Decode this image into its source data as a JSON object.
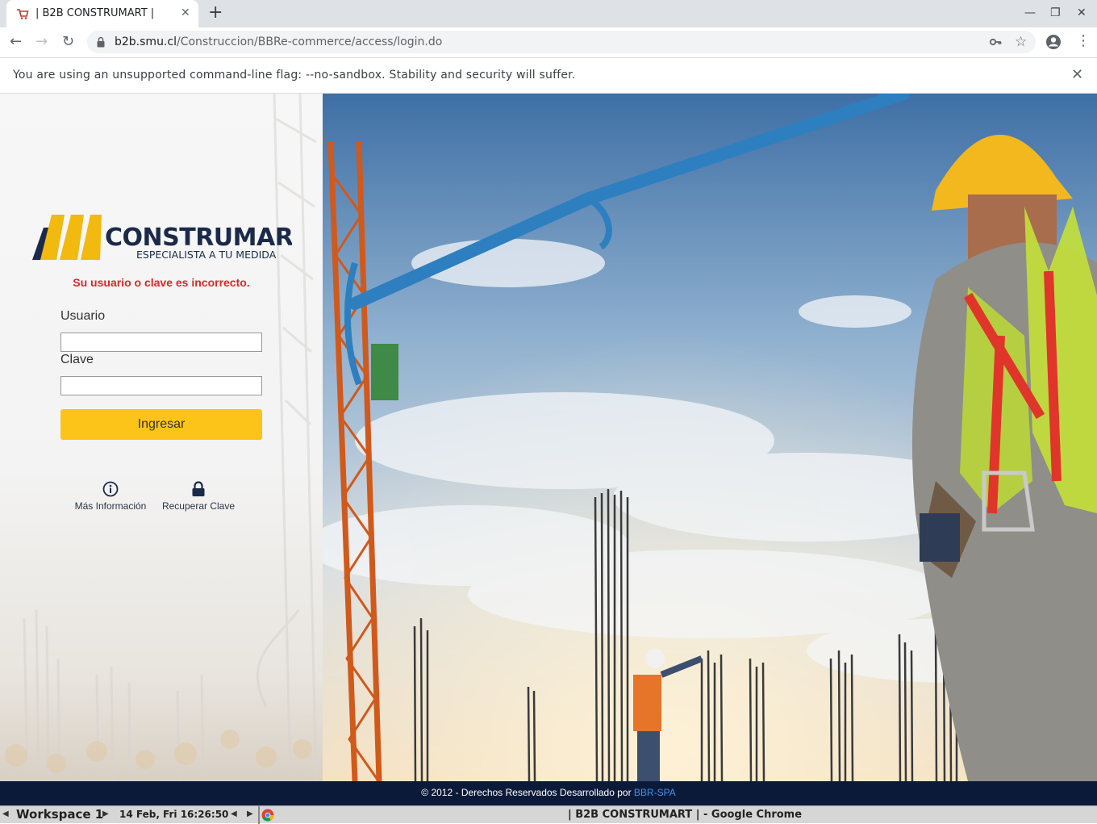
{
  "browser": {
    "tab_title": "| B2B CONSTRUMART |",
    "tab_close": "✕",
    "new_tab": "+",
    "window_controls": {
      "minimize": "—",
      "maximize": "❐",
      "close": "✕"
    },
    "nav": {
      "back": "←",
      "forward": "→",
      "reload": "↻"
    },
    "url_host": "b2b.smu.cl",
    "url_path": "/Construccion/BBRe-commerce/access/login.do",
    "bookmark_icon": "☆",
    "menu_icon": "⋮",
    "infobar_message": "You are using an unsupported command-line flag: --no-sandbox. Stability and security will suffer.",
    "infobar_close": "✕"
  },
  "login": {
    "logo_name": "CONSTRUMART",
    "logo_tagline": "ESPECIALISTA A TU MEDIDA",
    "error_message": "Su usuario o clave es incorrecto.",
    "user_label": "Usuario",
    "user_value": "",
    "password_label": "Clave",
    "password_value": "",
    "submit_label": "Ingresar",
    "links": [
      {
        "label": "Más Información",
        "icon": "info-icon"
      },
      {
        "label": "Recuperar Clave",
        "icon": "lock-icon"
      }
    ]
  },
  "footer": {
    "text": "© 2012 - Derechos Reservados Desarrollado por ",
    "link": "BBR-SPA"
  },
  "taskbar": {
    "workspace": "Workspace 1",
    "clock": "14 Feb, Fri 16:26:50",
    "window_title": "| B2B CONSTRUMART | - Google Chrome"
  },
  "colors": {
    "accent_yellow": "#fcc419",
    "brand_navy": "#1b2a4a",
    "error_red": "#e0252b",
    "footer_bg": "#0c1a3a"
  }
}
